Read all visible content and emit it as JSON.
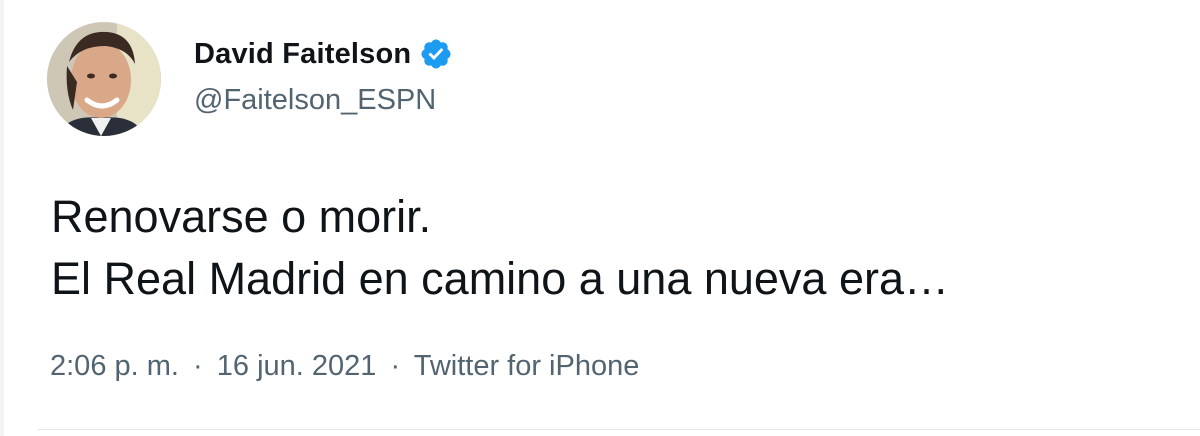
{
  "tweet": {
    "author": {
      "display_name": "David Faitelson",
      "handle": "@Faitelson_ESPN",
      "verified": true
    },
    "text_lines": [
      "Renovarse o morir.",
      "El Real Madrid en camino a una nueva era…"
    ],
    "time": "2:06 p. m.",
    "date": "16 jun. 2021",
    "source": "Twitter for iPhone",
    "separator": "·"
  },
  "colors": {
    "text_primary": "#0f1419",
    "text_secondary": "#536471",
    "verified_badge": "#1d9bf0"
  },
  "icons": {
    "verified": "verified-badge-icon",
    "avatar": "profile-photo"
  }
}
